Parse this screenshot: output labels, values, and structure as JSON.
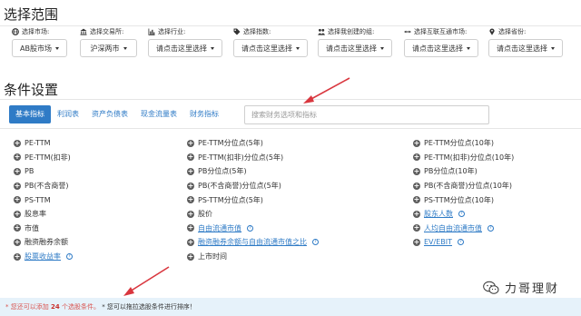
{
  "sections": {
    "range_title": "选择范围",
    "conditions_title": "条件设置"
  },
  "filters": [
    {
      "label": "选择市场:",
      "value": "AB股市场",
      "icon": "globe-icon"
    },
    {
      "label": "选择交易所:",
      "value": "沪深两市",
      "icon": "bank-icon"
    },
    {
      "label": "选择行业:",
      "value": "请点击这里选择",
      "icon": "bar-chart-icon"
    },
    {
      "label": "选择指数:",
      "value": "请点击这里选择",
      "icon": "tag-icon"
    },
    {
      "label": "选择我创建的组:",
      "value": "请点击这里选择",
      "icon": "users-icon"
    },
    {
      "label": "选择互联互通市场:",
      "value": "请点击这里选择",
      "icon": "arrows-icon"
    },
    {
      "label": "选择省份:",
      "value": "请点击这里选择",
      "icon": "map-pin-icon"
    }
  ],
  "tabs": [
    "基本指标",
    "利润表",
    "资产负债表",
    "现金流量表",
    "财务指标"
  ],
  "search": {
    "placeholder": "搜索财务选项和指标"
  },
  "indicators": {
    "col1": [
      "PE-TTM",
      "PE-TTM(扣非)",
      "PB",
      "PB(不含商誉)",
      "PS-TTM",
      "股息率",
      "市值",
      "融资融券余额",
      "股票收益率"
    ],
    "col2": [
      "PE-TTM分位点(5年)",
      "PE-TTM(扣非)分位点(5年)",
      "PB分位点(5年)",
      "PB(不含商誉)分位点(5年)",
      "PS-TTM分位点(5年)",
      "股价",
      "自由流通市值",
      "融资融券余额与自由流通市值之比",
      "上市时间"
    ],
    "col3": [
      "PE-TTM分位点(10年)",
      "PE-TTM(扣非)分位点(10年)",
      "PB分位点(10年)",
      "PB(不含商誉)分位点(10年)",
      "PS-TTM分位点(10年)",
      "股东人数",
      "人均自由流通市值",
      "EV/EBIT"
    ]
  },
  "notice": {
    "part1": "* 您还可以添加",
    "count": "24",
    "part2": "个选股条件。",
    "part3": "* 您可以拖拉选股条件进行排序！"
  },
  "watermark": {
    "text": "力哥理财"
  },
  "colors": {
    "accent": "#2f7bc6",
    "annotation_arrow": "#d9363e",
    "notice_bg": "#e6f2fa"
  }
}
